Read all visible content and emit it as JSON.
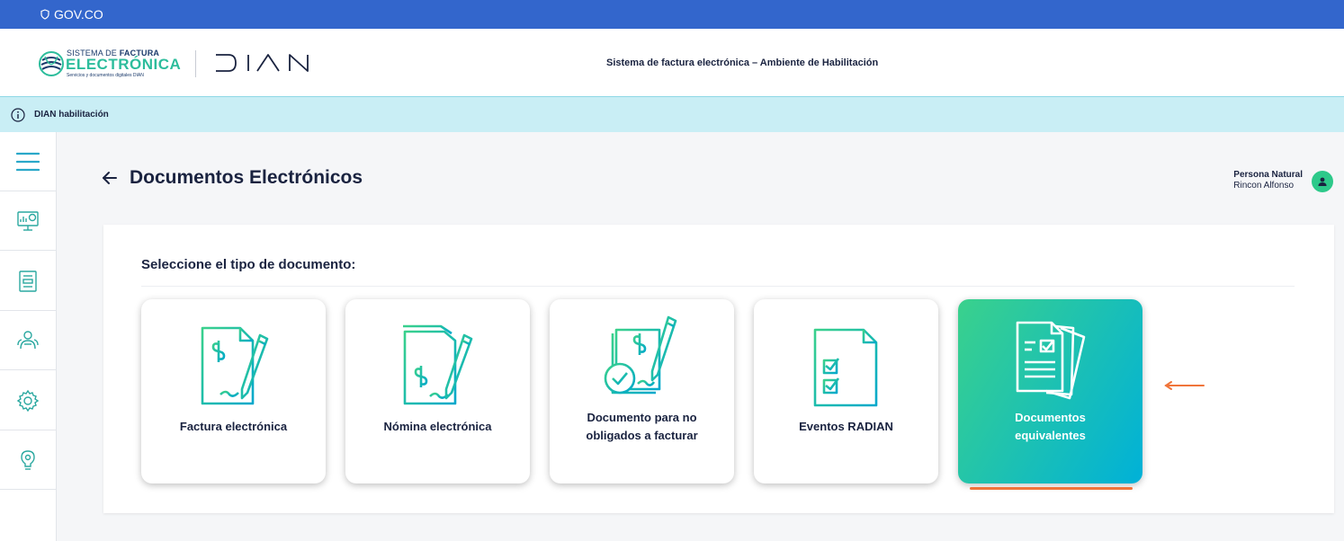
{
  "topbar": {
    "gov_label": "GOV.CO"
  },
  "header": {
    "logo_line1_a": "SISTEMA DE ",
    "logo_line1_b": "FACTURA",
    "logo_line2": "ELECTRÓNICA",
    "logo_line3": "Servicios y documentos digitales DIAN",
    "title": "Sistema de factura electrónica – Ambiente de Habilitación"
  },
  "infobar": {
    "text": "DIAN habilitación"
  },
  "sidebar": {
    "items": [
      {
        "icon": "menu-icon"
      },
      {
        "icon": "monitor-chart-icon"
      },
      {
        "icon": "document-list-icon"
      },
      {
        "icon": "people-icon"
      },
      {
        "icon": "gear-icon"
      },
      {
        "icon": "lightbulb-icon"
      }
    ]
  },
  "page": {
    "title": "Documentos Electrónicos"
  },
  "user": {
    "role": "Persona Natural",
    "name": "Rincon Alfonso"
  },
  "panel": {
    "title": "Seleccione el tipo de documento:",
    "cards": [
      {
        "label": "Factura electrónica"
      },
      {
        "label": "Nómina electrónica"
      },
      {
        "label_line1": "Documento para no",
        "label_line2": "obligados a facturar"
      },
      {
        "label": "Eventos RADIAN"
      },
      {
        "label_line1": "Documentos",
        "label_line2": "equivalentes"
      }
    ]
  },
  "colors": {
    "topbar": "#3366cc",
    "accent_green": "#2dbd9c",
    "accent_cyan": "#00b1d8",
    "indicator_orange": "#f0743a",
    "infobar": "#c9eef5"
  }
}
